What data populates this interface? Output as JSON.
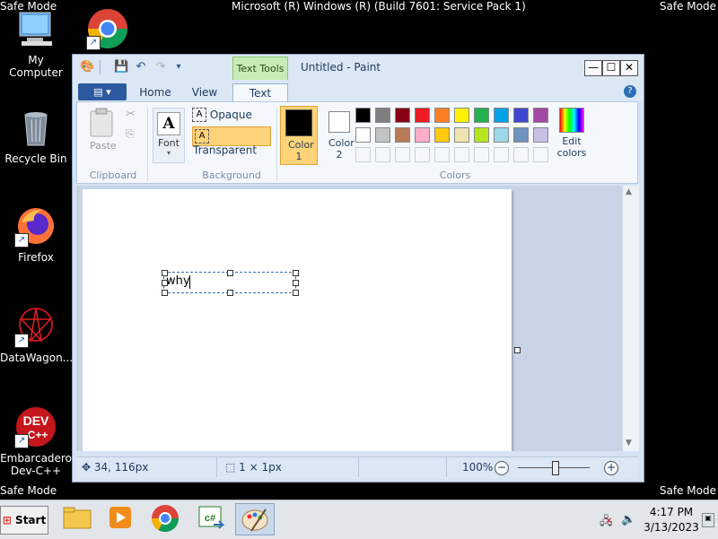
{
  "desktop": {
    "safe_mode_label": "Safe Mode",
    "os_title": "Microsoft (R) Windows (R) (Build 7601: Service Pack 1)",
    "icons": [
      {
        "label": "My Computer"
      },
      {
        "label": "Recycle Bin"
      },
      {
        "label": "Firefox"
      },
      {
        "label": "DataWagon..."
      },
      {
        "label": "Embarcadero Dev-C++"
      }
    ]
  },
  "paint": {
    "title": "Untitled - Paint",
    "context_tab": "Text Tools",
    "tabs": [
      "Home",
      "View",
      "Text"
    ],
    "active_tab": "Text",
    "groups": {
      "clipboard": {
        "label": "Clipboard",
        "paste": "Paste"
      },
      "font": {
        "label": "Font"
      },
      "background": {
        "label": "Background",
        "opaque": "Opaque",
        "transparent": "Transparent"
      },
      "colors": {
        "label": "Colors",
        "color1": "Color 1",
        "color2": "Color 2",
        "edit_colors": "Edit colors"
      }
    },
    "color1_value": "#000000",
    "color2_value": "#ffffff",
    "palette_row1": [
      "#000000",
      "#7f7f7f",
      "#880015",
      "#ed1c24",
      "#ff7f27",
      "#fff200",
      "#22b14c",
      "#00a2e8",
      "#3f48cc",
      "#a349a4"
    ],
    "palette_row2": [
      "#ffffff",
      "#c3c3c3",
      "#b97a57",
      "#ffaec9",
      "#ffc90e",
      "#efe4b0",
      "#b5e61d",
      "#99d9ea",
      "#7092be",
      "#c8bfe7"
    ],
    "canvas_text": "why",
    "status": {
      "cursor_pos": "34, 116px",
      "selection_size": "1 × 1px",
      "zoom": "100%"
    }
  },
  "taskbar": {
    "start_label": "Start",
    "clock_time": "4:17 PM",
    "clock_date": "3/13/2023"
  }
}
